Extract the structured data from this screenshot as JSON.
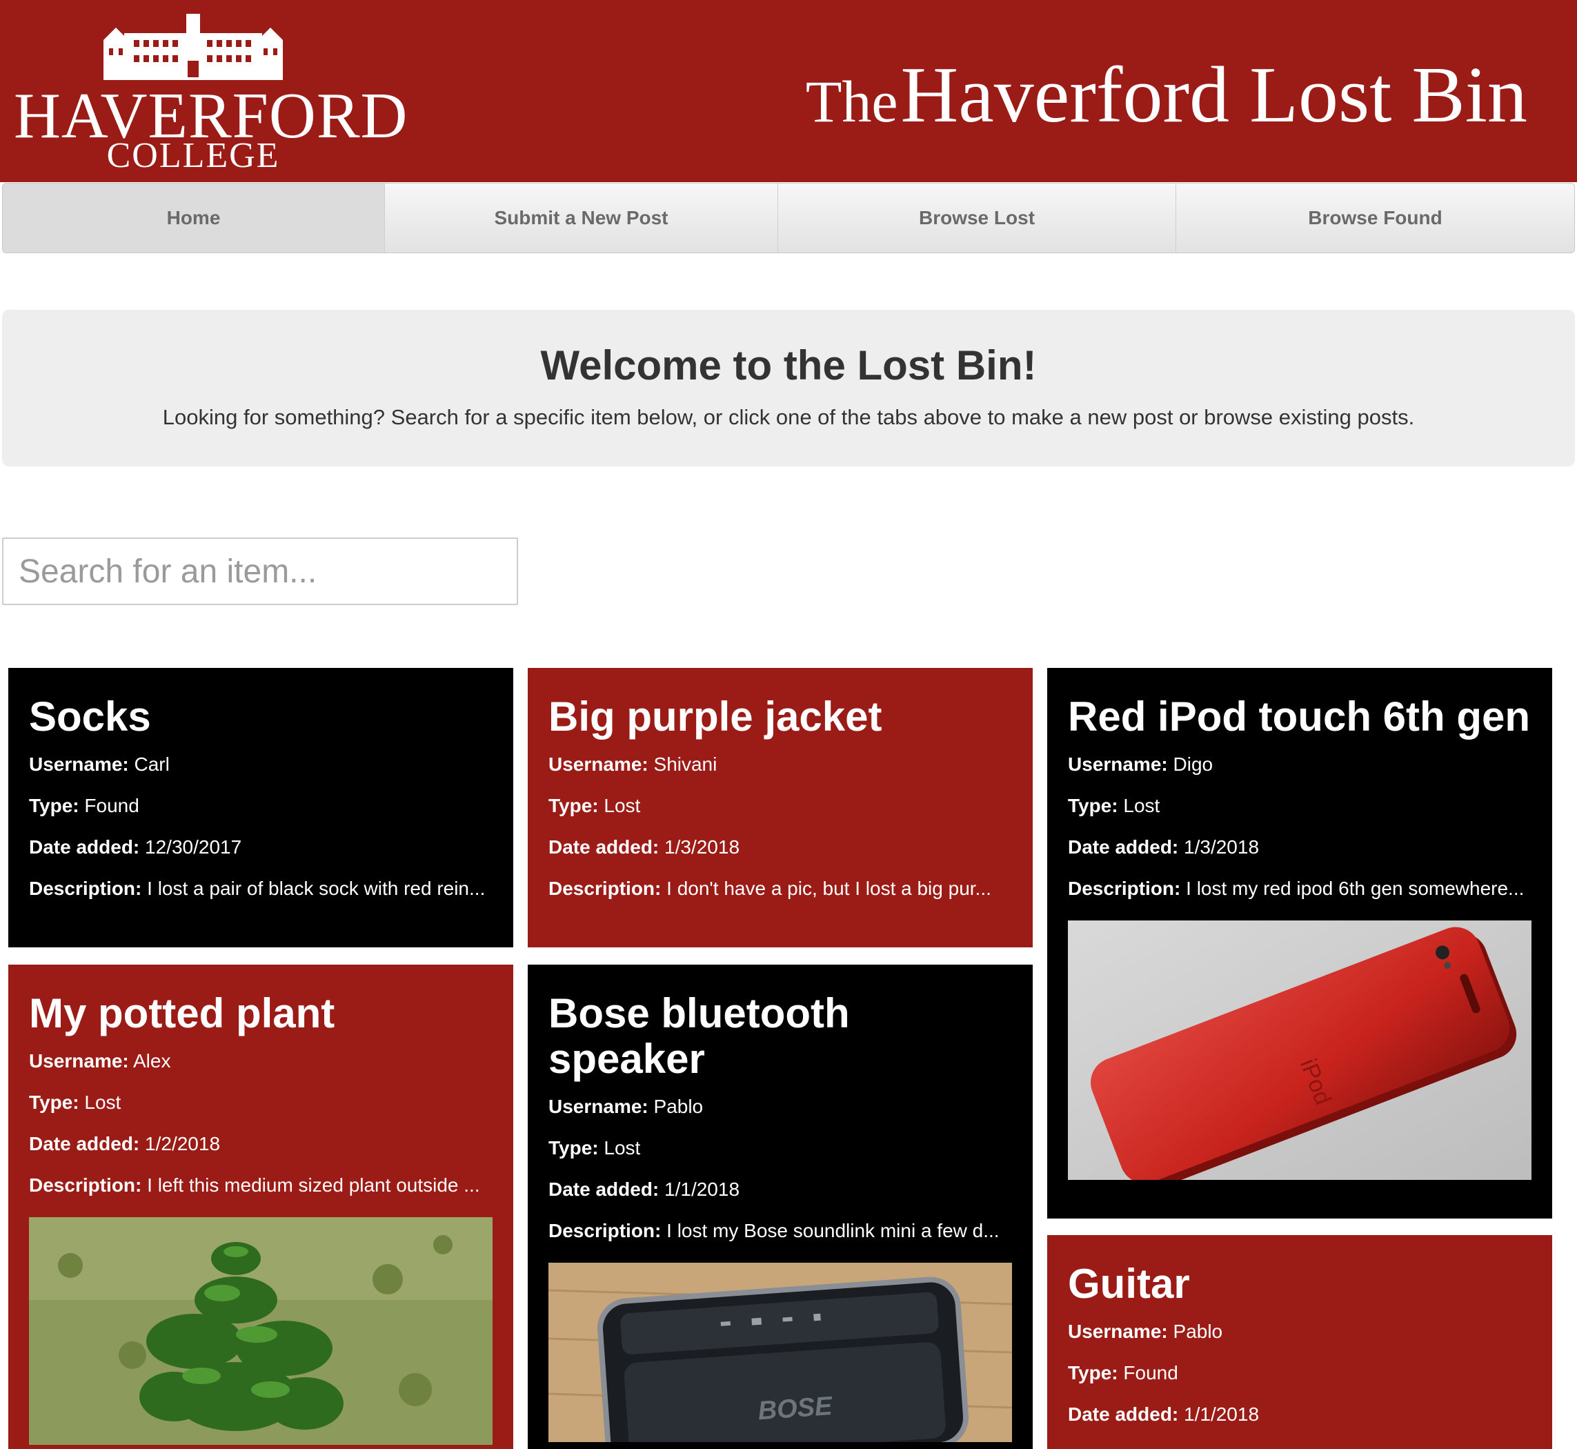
{
  "header": {
    "logo_name": "HAVERFORD",
    "logo_sub": "COLLEGE",
    "title_the": "The",
    "title_rest": "Haverford Lost Bin",
    "background_color": "#9b1c17"
  },
  "nav": {
    "tabs": [
      {
        "label": "Home",
        "active": true
      },
      {
        "label": "Submit a New Post",
        "active": false
      },
      {
        "label": "Browse Lost",
        "active": false
      },
      {
        "label": "Browse Found",
        "active": false
      }
    ]
  },
  "welcome": {
    "title": "Welcome to the Lost Bin!",
    "text": "Looking for something? Search for a specific item below, or click one of the tabs above to make a new post or browse existing posts."
  },
  "search": {
    "placeholder": "Search for an item...",
    "value": ""
  },
  "labels": {
    "username": "Username:",
    "type": "Type:",
    "date": "Date added:",
    "description": "Description:"
  },
  "posts": [
    {
      "title": "Socks",
      "username": "Carl",
      "type": "Found",
      "date": "12/30/2017",
      "description": "I lost a pair of black sock with red rein...",
      "color": "black",
      "photo": "none"
    },
    {
      "title": "Big purple jacket",
      "username": "Shivani",
      "type": "Lost",
      "date": "1/3/2018",
      "description": "I don't have a pic, but I lost a big pur...",
      "color": "red",
      "photo": "none"
    },
    {
      "title": "Red iPod touch 6th gen",
      "username": "Digo",
      "type": "Lost",
      "date": "1/3/2018",
      "description": "I lost my red ipod 6th gen somewhere...",
      "color": "black",
      "photo": "red-ipod-photo"
    },
    {
      "title": "My potted plant",
      "username": "Alex",
      "type": "Lost",
      "date": "1/2/2018",
      "description": "I left this medium sized plant outside ...",
      "color": "red",
      "photo": "plant-photo"
    },
    {
      "title": "Bose bluetooth speaker",
      "username": "Pablo",
      "type": "Lost",
      "date": "1/1/2018",
      "description": "I lost my Bose soundlink mini a few d...",
      "color": "black",
      "photo": "speaker-photo",
      "speaker_brand": "BOSE"
    },
    {
      "title": "Guitar",
      "username": "Pablo",
      "type": "Found",
      "date": "1/1/2018",
      "description": "",
      "color": "red",
      "photo": "none"
    }
  ]
}
